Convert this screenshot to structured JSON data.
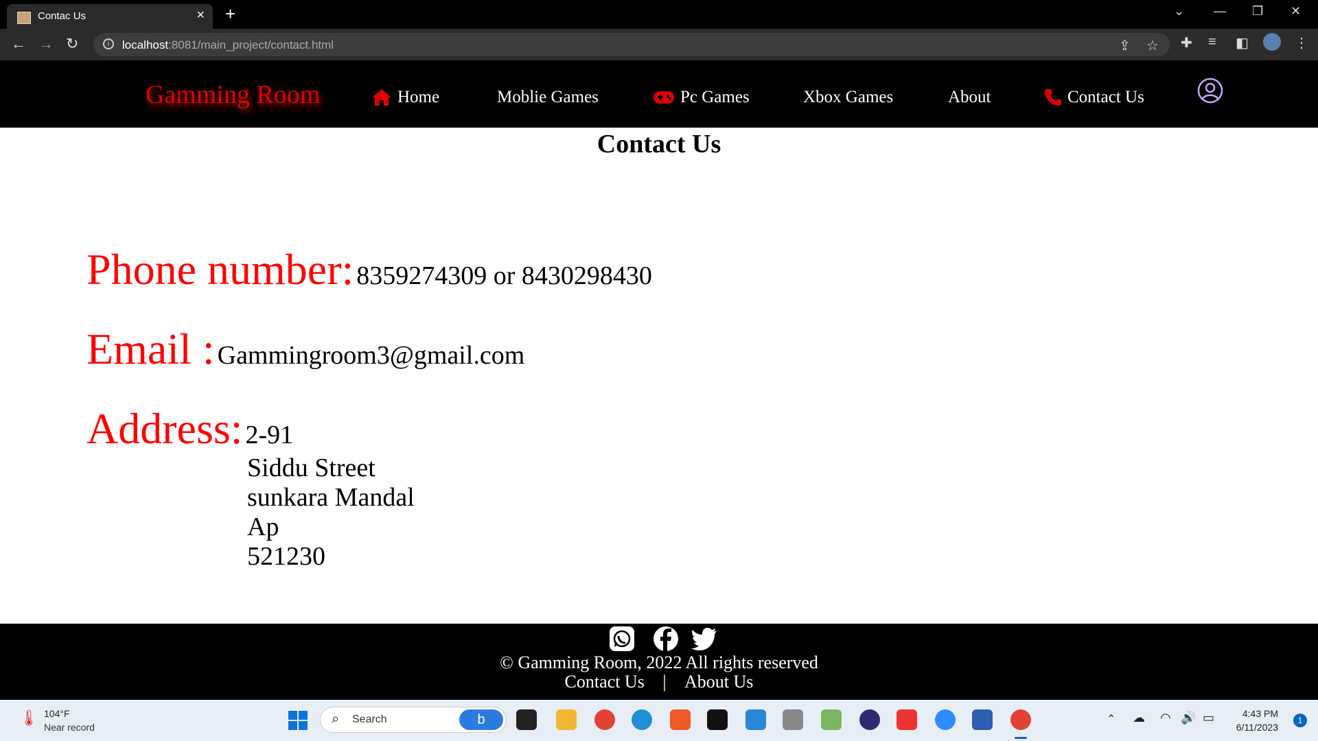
{
  "browser": {
    "tab_title": "Contac Us",
    "url_host": "localhost",
    "url_path": ":8081/main_project/contact.html"
  },
  "header": {
    "brand": "Gamming Room",
    "nav": [
      {
        "label": "Home",
        "icon": "home-icon"
      },
      {
        "label": "Moblie Games",
        "icon": ""
      },
      {
        "label": "Pc Games",
        "icon": "gamepad-icon"
      },
      {
        "label": "Xbox Games",
        "icon": ""
      },
      {
        "label": "About",
        "icon": ""
      },
      {
        "label": "Contact Us",
        "icon": "phone-icon"
      }
    ],
    "accent_color": "#ff0000"
  },
  "main": {
    "title": "Contact Us",
    "phone_label": "Phone number:",
    "phone_value": "8359274309 or 8430298430",
    "email_label": "Email :",
    "email_value": "Gammingroom3@gmail.com",
    "address_label": "Address:",
    "address_lines": [
      "2-91",
      "Siddu Street",
      "sunkara Mandal",
      "Ap",
      "521230"
    ]
  },
  "footer": {
    "social_icons": [
      "whatsapp-icon",
      "facebook-icon",
      "twitter-icon"
    ],
    "copyright": "© Gamming Room, 2022 All rights reserved",
    "link_contact": "Contact Us",
    "separator": "|",
    "link_about": "About Us"
  },
  "taskbar": {
    "weather_temp": "104°F",
    "weather_desc": "Near record",
    "search_label": "Search",
    "time": "4:43 PM",
    "date": "6/11/2023",
    "notification_count": "1"
  }
}
